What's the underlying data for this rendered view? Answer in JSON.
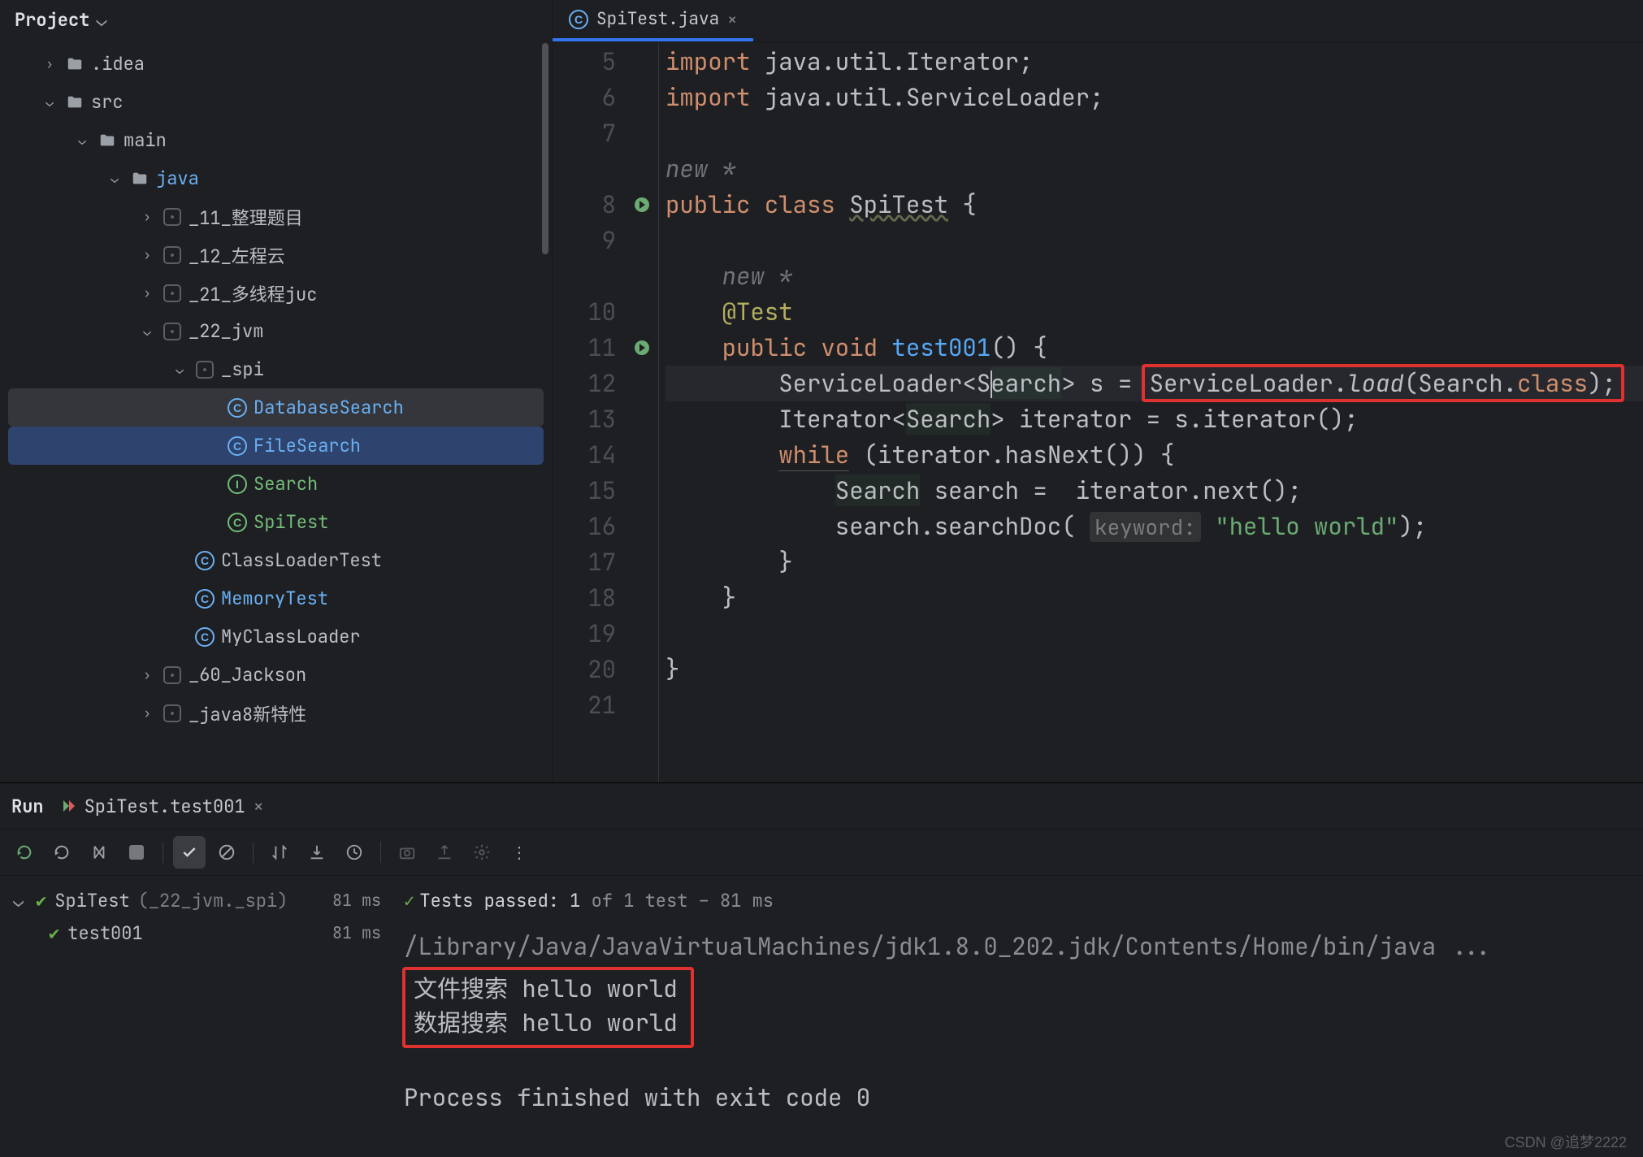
{
  "project": {
    "header": "Project",
    "tree": [
      {
        "indent": 40,
        "caret": "›",
        "icon": "folder",
        "label": ".idea"
      },
      {
        "indent": 40,
        "caret": "⌄",
        "icon": "folder",
        "label": "src"
      },
      {
        "indent": 80,
        "caret": "⌄",
        "icon": "folder",
        "label": "main"
      },
      {
        "indent": 120,
        "caret": "⌄",
        "icon": "folder",
        "label": "java",
        "labelClass": "lbl-blue"
      },
      {
        "indent": 160,
        "caret": "›",
        "icon": "pkg",
        "label": "_11_整理题目"
      },
      {
        "indent": 160,
        "caret": "›",
        "icon": "pkg",
        "label": "_12_左程云"
      },
      {
        "indent": 160,
        "caret": "›",
        "icon": "pkg",
        "label": "_21_多线程juc"
      },
      {
        "indent": 160,
        "caret": "⌄",
        "icon": "pkg",
        "label": "_22_jvm"
      },
      {
        "indent": 200,
        "caret": "⌄",
        "icon": "pkg",
        "label": "_spi"
      },
      {
        "indent": 240,
        "caret": "",
        "icon": "C-blue",
        "label": "DatabaseSearch",
        "labelClass": "lbl-blue"
      },
      {
        "indent": 240,
        "caret": "",
        "icon": "C-blue",
        "label": "FileSearch",
        "labelClass": "lbl-blue",
        "state": "selected"
      },
      {
        "indent": 240,
        "caret": "",
        "icon": "I-green",
        "label": "Search",
        "labelClass": "lbl-green"
      },
      {
        "indent": 240,
        "caret": "",
        "icon": "C-green",
        "label": "SpiTest",
        "labelClass": "lbl-green"
      },
      {
        "indent": 200,
        "caret": "",
        "icon": "C-blue",
        "label": "ClassLoaderTest"
      },
      {
        "indent": 200,
        "caret": "",
        "icon": "C-blue",
        "label": "MemoryTest",
        "labelClass": "lbl-blue"
      },
      {
        "indent": 200,
        "caret": "",
        "icon": "C-blue",
        "label": "MyClassLoader"
      },
      {
        "indent": 160,
        "caret": "›",
        "icon": "pkg",
        "label": "_60_Jackson"
      },
      {
        "indent": 160,
        "caret": "›",
        "icon": "pkg",
        "label": "_java8新特性"
      }
    ]
  },
  "editor": {
    "tab": {
      "file": "SpiTest.java",
      "active": true
    },
    "lines": [
      5,
      6,
      7,
      8,
      9,
      10,
      11,
      12,
      13,
      14,
      15,
      16,
      17,
      18,
      19,
      20,
      21
    ],
    "gutterMarks": {
      "8": "run",
      "11": "run"
    },
    "code": {
      "l5": "import java.util.Iterator;",
      "l6": "import java.util.ServiceLoader;",
      "l7": "",
      "l7b": "new *",
      "l8": "public class SpiTest {",
      "l9": "",
      "l9b": "    new *",
      "l10": "    @Test",
      "l11": "    public void test001() {",
      "l12a": "        ServiceLoader<S",
      "l12b": "earch",
      "l12c": "> s = ",
      "l12d": "ServiceLoader.load(Search.class);",
      "l13": "        Iterator<Search> iterator = s.iterator();",
      "l14": "        while (iterator.hasNext()) {",
      "l15": "            Search search =  iterator.next();",
      "l16a": "            search.searchDoc( ",
      "l16h": "keyword:",
      "l16b": " \"hello world\");",
      "l17": "        }",
      "l18": "    }",
      "l19": "",
      "l20": "}",
      "l21": ""
    }
  },
  "run": {
    "label": "Run",
    "tab": "SpiTest.test001",
    "toolbar_icons": [
      "rerun",
      "rerun-failed",
      "toggle-auto",
      "stop",
      "sep",
      "pass-check",
      "skip",
      "sep",
      "sort",
      "import",
      "history",
      "sep",
      "camera",
      "export",
      "gear",
      "more"
    ],
    "testTree": {
      "root": {
        "name": "SpiTest",
        "pkg": "(_22_jvm._spi)",
        "time": "81 ms"
      },
      "child": {
        "name": "test001",
        "time": "81 ms"
      }
    },
    "status": {
      "pass": "✓",
      "text": "Tests passed: 1",
      "suffix": " of 1 test – 81 ms"
    },
    "console": {
      "jdk": "/Library/Java/JavaVirtualMachines/jdk1.8.0_202.jdk/Contents/Home/bin/java ...",
      "out1": "文件搜索 hello world",
      "out2": "数据搜索 hello world",
      "exit": "Process finished with exit code 0"
    }
  },
  "watermark": "CSDN @追梦2222"
}
